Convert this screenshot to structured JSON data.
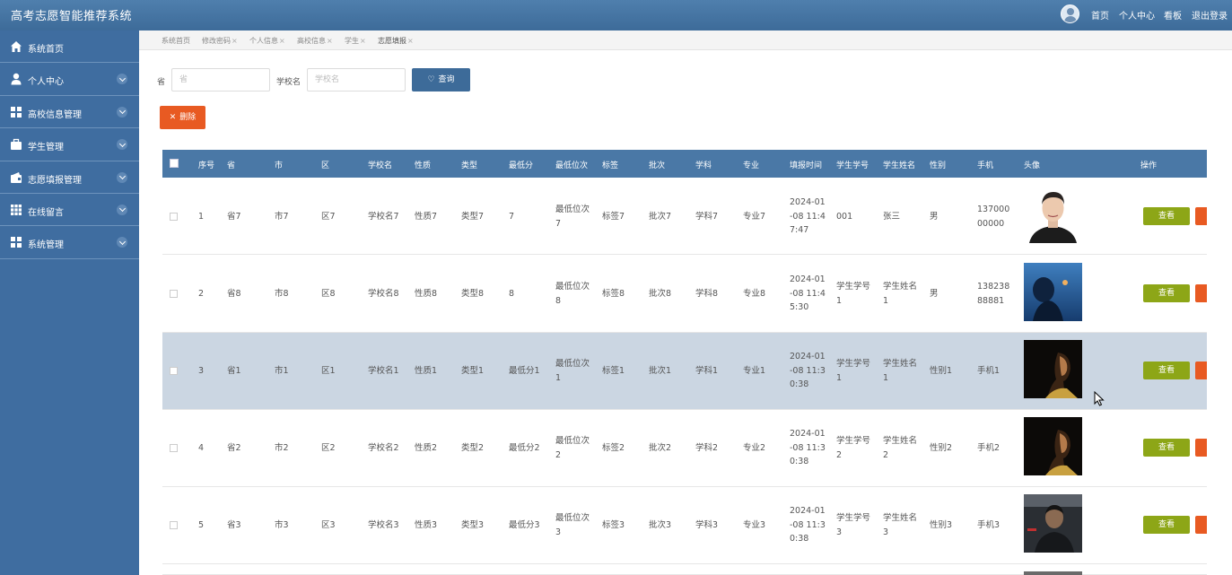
{
  "header": {
    "title": "高考志愿智能推荐系统",
    "links": [
      "首页",
      "个人中心",
      "看板",
      "退出登录"
    ]
  },
  "sidebar": {
    "items": [
      {
        "label": "系统首页",
        "icon": "home-icon"
      },
      {
        "label": "个人中心",
        "icon": "user-icon"
      },
      {
        "label": "高校信息管理",
        "icon": "grid-icon"
      },
      {
        "label": "学生管理",
        "icon": "briefcase-icon"
      },
      {
        "label": "志愿填报管理",
        "icon": "wallet-icon"
      },
      {
        "label": "在线留言",
        "icon": "apps-icon"
      },
      {
        "label": "系统管理",
        "icon": "grid-icon"
      }
    ]
  },
  "tabs": [
    {
      "label": "系统首页",
      "closable": false
    },
    {
      "label": "修改密码",
      "closable": true
    },
    {
      "label": "个人信息",
      "closable": true
    },
    {
      "label": "高校信息",
      "closable": true
    },
    {
      "label": "学生",
      "closable": true
    },
    {
      "label": "志愿填报",
      "closable": true
    }
  ],
  "search": {
    "province_label": "省",
    "province_placeholder": "省",
    "school_label": "学校名",
    "school_placeholder": "学校名",
    "query_button": "查询",
    "delete_button": "删除"
  },
  "table": {
    "headers": [
      "序号",
      "省",
      "市",
      "区",
      "学校名",
      "性质",
      "类型",
      "最低分",
      "最低位次",
      "标签",
      "批次",
      "学科",
      "专业",
      "填报时间",
      "学生学号",
      "学生姓名",
      "性别",
      "手机",
      "头像",
      "操作"
    ],
    "view_label": "查看",
    "rows": [
      {
        "cells": [
          "1",
          "省7",
          "市7",
          "区7",
          "学校名7",
          "性质7",
          "类型7",
          "7",
          "最低位次7",
          "标签7",
          "批次7",
          "学科7",
          "专业7",
          "2024-01-08 11:47:47",
          "001",
          "张三",
          "男",
          "13700000000"
        ],
        "photo": "portrait-white"
      },
      {
        "cells": [
          "2",
          "省8",
          "市8",
          "区8",
          "学校名8",
          "性质8",
          "类型8",
          "8",
          "最低位次8",
          "标签8",
          "批次8",
          "学科8",
          "专业8",
          "2024-01-08 11:45:30",
          "学生学号1",
          "学生姓名1",
          "男",
          "13823888881"
        ],
        "photo": "blue-water"
      },
      {
        "cells": [
          "3",
          "省1",
          "市1",
          "区1",
          "学校名1",
          "性质1",
          "类型1",
          "最低分1",
          "最低位次1",
          "标签1",
          "批次1",
          "学科1",
          "专业1",
          "2024-01-08 11:30:38",
          "学生学号1",
          "学生姓名1",
          "性别1",
          "手机1"
        ],
        "photo": "dark-profile",
        "highlighted": true
      },
      {
        "cells": [
          "4",
          "省2",
          "市2",
          "区2",
          "学校名2",
          "性质2",
          "类型2",
          "最低分2",
          "最低位次2",
          "标签2",
          "批次2",
          "学科2",
          "专业2",
          "2024-01-08 11:30:38",
          "学生学号2",
          "学生姓名2",
          "性别2",
          "手机2"
        ],
        "photo": "dark-profile"
      },
      {
        "cells": [
          "5",
          "省3",
          "市3",
          "区3",
          "学校名3",
          "性质3",
          "类型3",
          "最低分3",
          "最低位次3",
          "标签3",
          "批次3",
          "学科3",
          "专业3",
          "2024-01-08 11:30:38",
          "学生学号3",
          "学生姓名3",
          "性别3",
          "手机3"
        ],
        "photo": "gym-dark"
      }
    ]
  },
  "colors": {
    "header": "#3d6b99",
    "sidebar": "#3f6da0",
    "table_header": "#4a78a6",
    "highlight_row": "#cbd6e2",
    "view_button": "#8da617",
    "delete_button": "#e85a22"
  }
}
